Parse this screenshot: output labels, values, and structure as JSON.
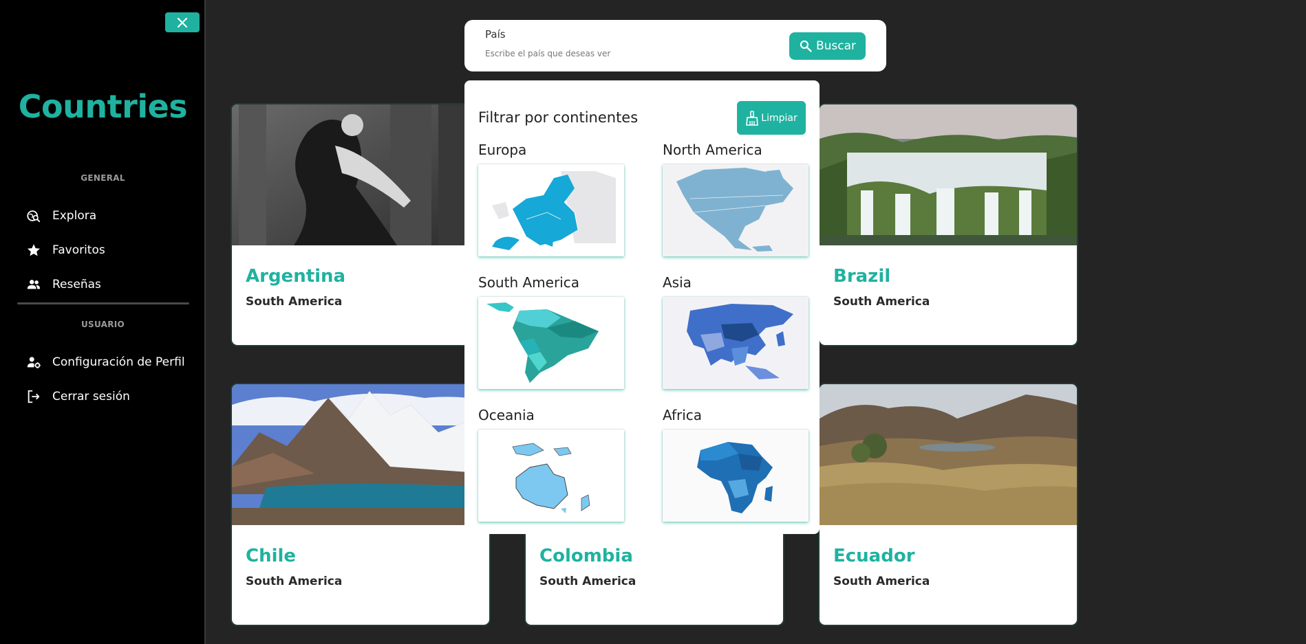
{
  "sidebar": {
    "brand": "Countries",
    "section_general": "GENERAL",
    "section_user": "USUARIO",
    "items": [
      {
        "label": "Explora",
        "icon": "explore-icon"
      },
      {
        "label": "Favoritos",
        "icon": "star-icon"
      },
      {
        "label": "Reseñas",
        "icon": "people-icon"
      },
      {
        "label": "Configuración de Perfil",
        "icon": "user-settings-icon"
      },
      {
        "label": "Cerrar sesión",
        "icon": "logout-icon"
      }
    ]
  },
  "search": {
    "label": "País",
    "placeholder": "Escribe el país que deseas ver",
    "button_label": "Buscar"
  },
  "filter": {
    "title": "Filtrar por continentes",
    "clear_label": "Limpiar",
    "continents": [
      "Europa",
      "North America",
      "South America",
      "Asia",
      "Oceania",
      "Africa"
    ]
  },
  "cards": [
    {
      "name": "Argentina",
      "continent": "South America"
    },
    {
      "name": "Brazil",
      "continent": "South America"
    },
    {
      "name": "Chile",
      "continent": "South America"
    },
    {
      "name": "Colombia",
      "continent": "South America"
    },
    {
      "name": "Ecuador",
      "continent": "South America"
    }
  ],
  "colors": {
    "accent": "#1fb2a0",
    "background": "#242424",
    "sidebar": "#000000"
  }
}
